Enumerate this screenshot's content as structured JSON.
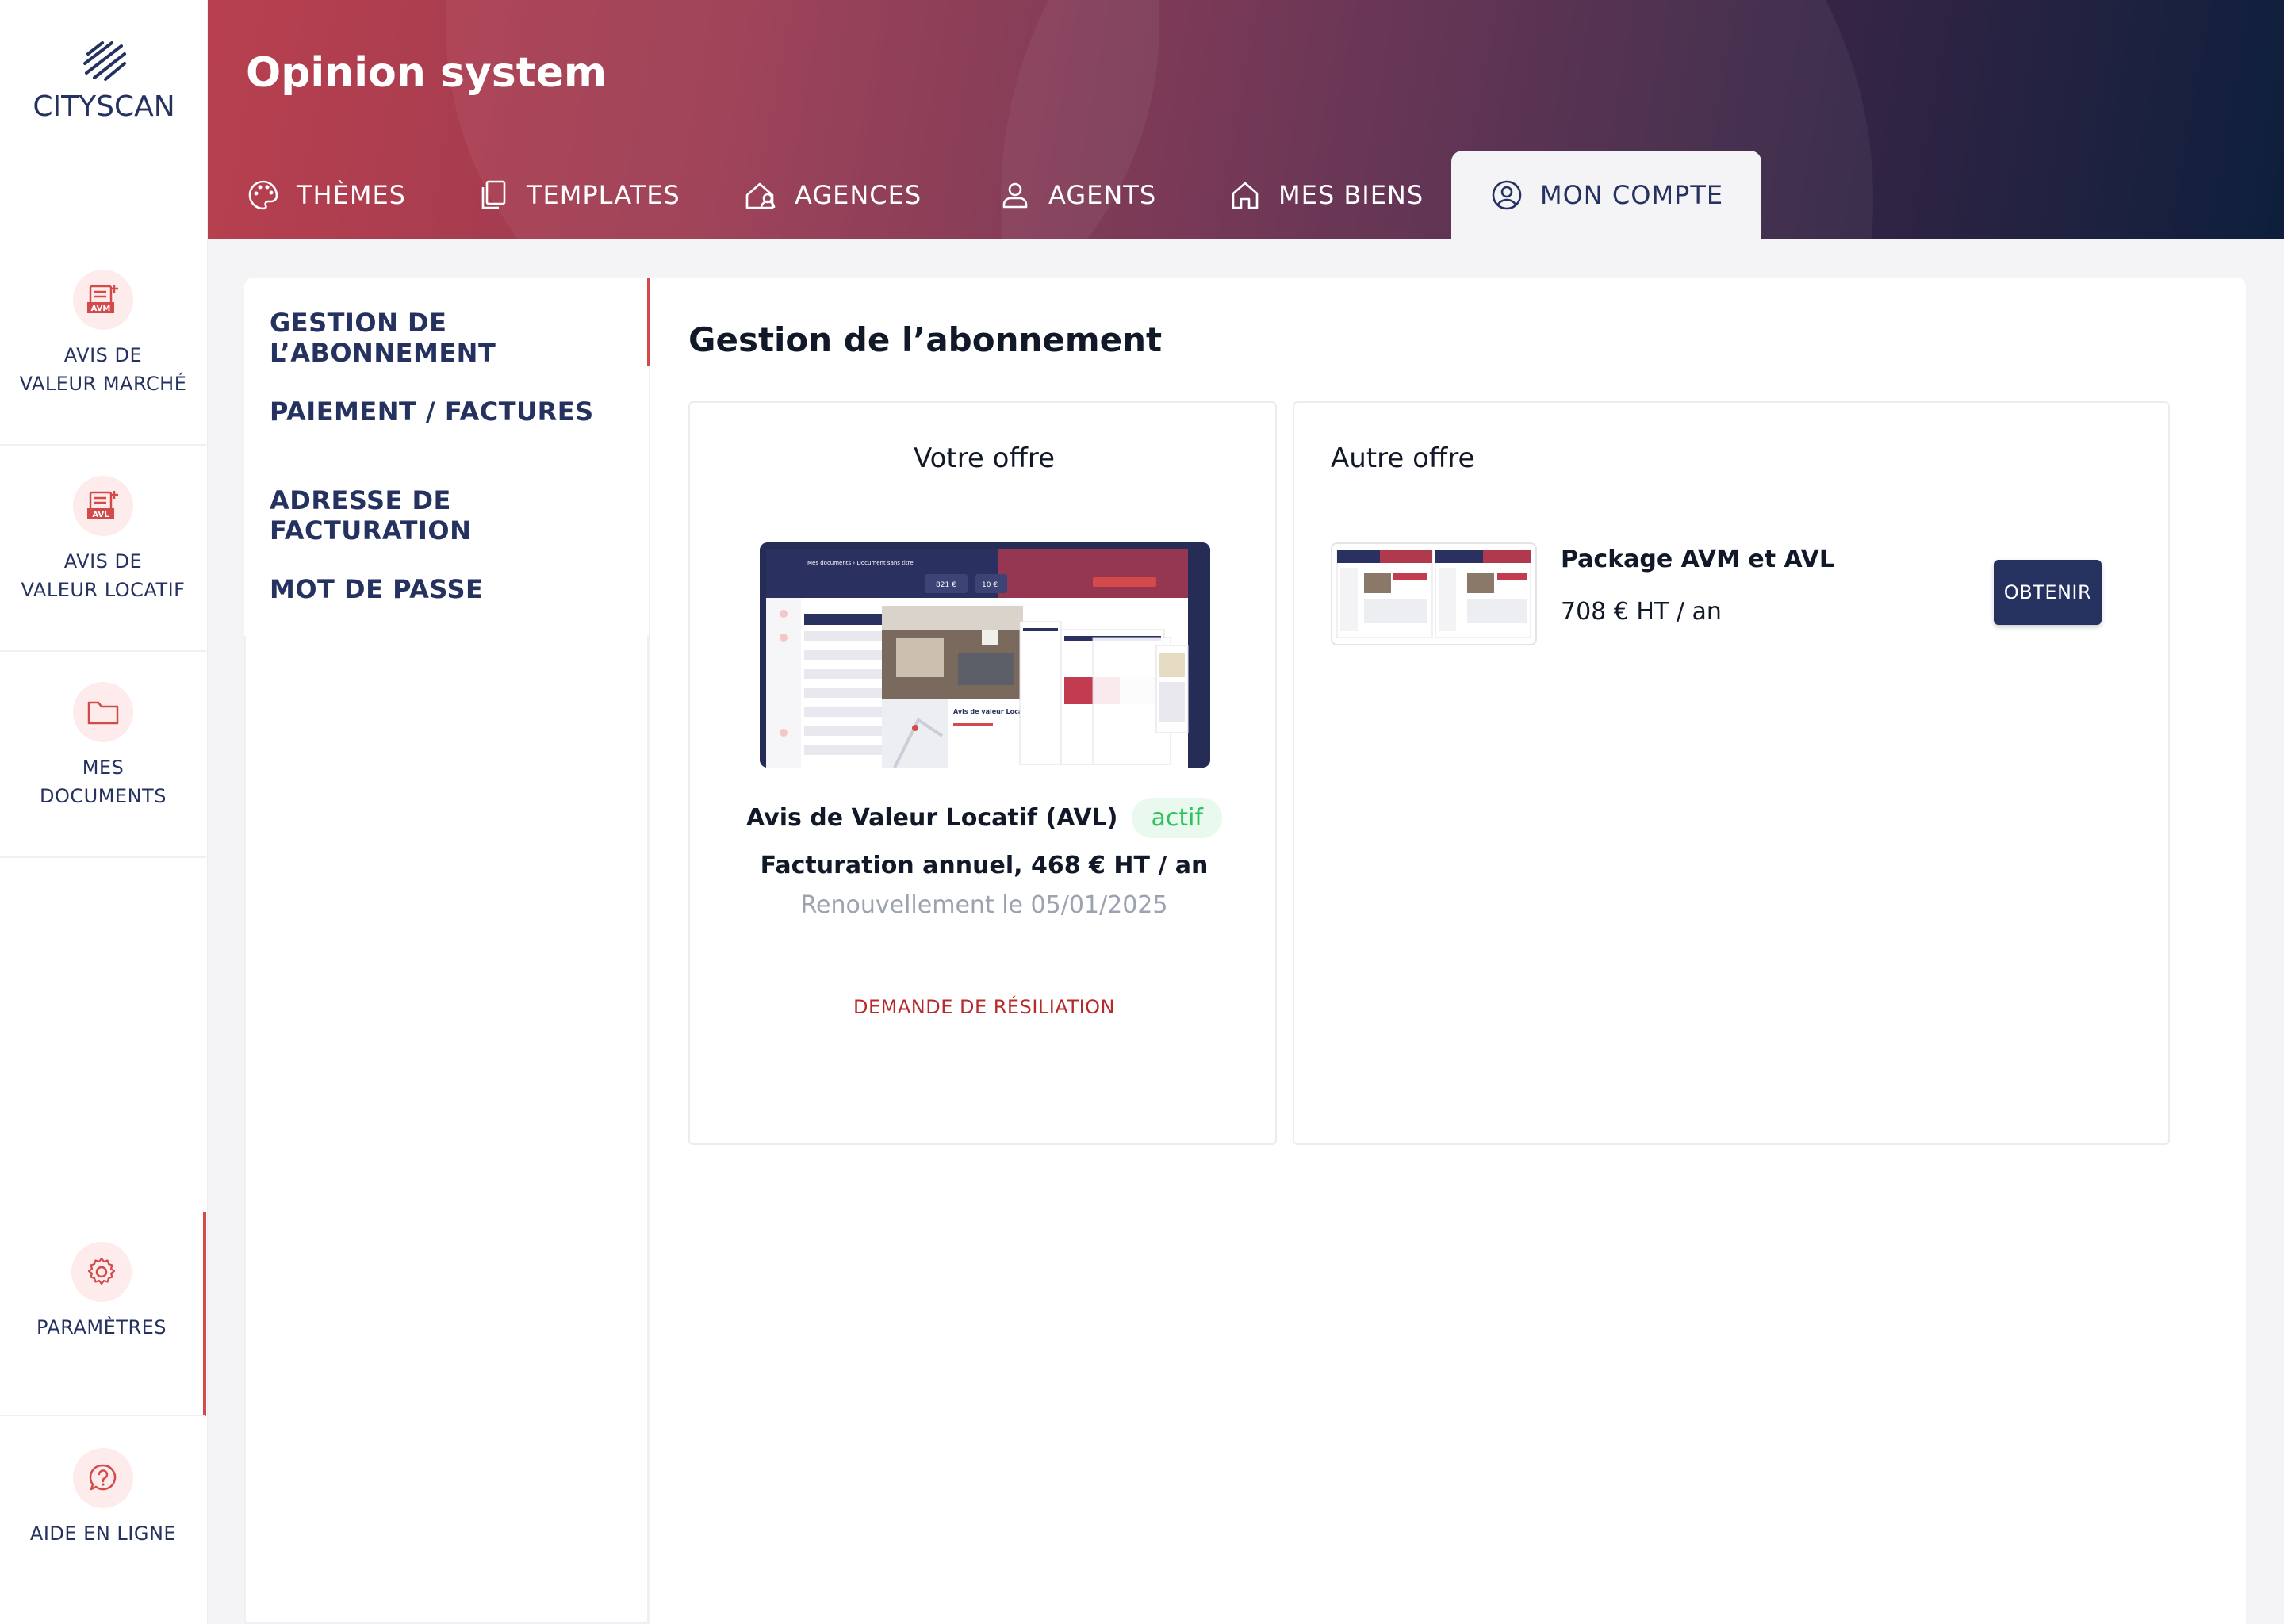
{
  "brand": {
    "logo_text": "CITYSCAN"
  },
  "header": {
    "title": "Opinion system"
  },
  "tabs": [
    {
      "label": "THÈMES",
      "icon": "palette-icon"
    },
    {
      "label": "TEMPLATES",
      "icon": "copy-icon"
    },
    {
      "label": "AGENCES",
      "icon": "agency-icon"
    },
    {
      "label": "AGENTS",
      "icon": "user-icon"
    },
    {
      "label": "MES BIENS",
      "icon": "home-icon"
    },
    {
      "label": "MON COMPTE",
      "icon": "account-circle-icon",
      "active": true
    }
  ],
  "sidebar": {
    "items": [
      {
        "label": "AVIS DE\nVALEUR MARCHÉ",
        "icon": "avm-doc-icon",
        "icon_text": "AVM"
      },
      {
        "label": "AVIS DE\nVALEUR LOCATIF",
        "icon": "avl-doc-icon",
        "icon_text": "AVL"
      },
      {
        "label": "MES\nDOCUMENTS",
        "icon": "folder-icon"
      },
      {
        "label": "PARAMÈTRES",
        "icon": "gear-icon",
        "active": true
      },
      {
        "label": "AIDE EN LIGNE",
        "icon": "help-icon"
      }
    ]
  },
  "subnav": {
    "items": [
      {
        "label": "GESTION DE L’ABONNEMENT",
        "active": true
      },
      {
        "label": "PAIEMENT / FACTURES"
      },
      {
        "label": "ADRESSE DE FACTURATION"
      },
      {
        "label": "MOT DE PASSE"
      }
    ]
  },
  "main": {
    "title": "Gestion de l’abonnement",
    "current_offer": {
      "heading": "Votre offre",
      "product": "Avis de Valeur Locatif (AVL)",
      "status": "actif",
      "billing": "Facturation annuel, 468 € HT / an",
      "renewal": "Renouvellement le 05/01/2025",
      "cancel_label": "DEMANDE DE RÉSILIATION",
      "preview": {
        "title": "Mes documents › Document sans titre",
        "stat1": "821 €",
        "stat2": "10 €",
        "overlay": "Avis de valeur Locatif"
      }
    },
    "other_offer": {
      "heading": "Autre offre",
      "package": "Package AVM et AVL",
      "price": "708 € HT / an",
      "button_label": "OBTENIR"
    }
  },
  "colors": {
    "accent_red": "#d34a4a",
    "navy": "#253260",
    "status_green": "#2ec25e",
    "cancel_red": "#b52a2a"
  }
}
